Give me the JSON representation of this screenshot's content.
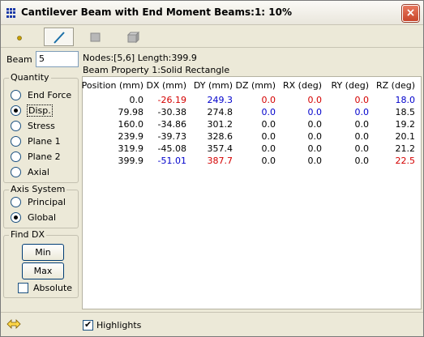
{
  "window": {
    "title": "Cantilever Beam with End Moment Beams:1: 10%",
    "close_glyph": "×"
  },
  "toolbar": {
    "buttons": [
      {
        "icon": "node-dot-icon",
        "active": false
      },
      {
        "icon": "beam-line-icon",
        "active": true
      },
      {
        "icon": "plate-icon",
        "active": false
      },
      {
        "icon": "brick-icon",
        "active": false
      }
    ]
  },
  "beam": {
    "label": "Beam",
    "value": "5"
  },
  "info": {
    "nodes_line": "Nodes:[5,6] Length:399.9",
    "property_line": "Beam Property 1:Solid Rectangle"
  },
  "quantity": {
    "title": "Quantity",
    "options": [
      "End Force",
      "Disp.",
      "Stress",
      "Plane 1",
      "Plane 2",
      "Axial"
    ],
    "selected": "Disp."
  },
  "axis_system": {
    "title": "Axis System",
    "options": [
      "Principal",
      "Global"
    ],
    "selected": "Global"
  },
  "find_dx": {
    "title": "Find DX",
    "min_label": "Min",
    "max_label": "Max",
    "absolute_label": "Absolute",
    "absolute_checked": false
  },
  "table": {
    "headers": [
      "Position (mm)",
      "DX (mm)",
      "DY (mm)",
      "DZ (mm)",
      "RX (deg)",
      "RY (deg)",
      "RZ (deg)"
    ],
    "rows": [
      [
        "0.0",
        "-26.19",
        "249.3",
        "0.0",
        "0.0",
        "0.0",
        "18.0"
      ],
      [
        "79.98",
        "-30.38",
        "274.8",
        "0.0",
        "0.0",
        "0.0",
        "18.5"
      ],
      [
        "160.0",
        "-34.86",
        "301.2",
        "0.0",
        "0.0",
        "0.0",
        "19.2"
      ],
      [
        "239.9",
        "-39.73",
        "328.6",
        "0.0",
        "0.0",
        "0.0",
        "20.1"
      ],
      [
        "319.9",
        "-45.08",
        "357.4",
        "0.0",
        "0.0",
        "0.0",
        "21.2"
      ],
      [
        "399.9",
        "-51.01",
        "387.7",
        "0.0",
        "0.0",
        "0.0",
        "22.5"
      ]
    ],
    "colors": [
      [
        "#000000",
        "#d40000",
        "#0000cc",
        "#d40000",
        "#d40000",
        "#d40000",
        "#0000cc"
      ],
      [
        "#000000",
        "#000000",
        "#000000",
        "#0000cc",
        "#0000cc",
        "#0000cc",
        "#000000"
      ],
      [
        "#000000",
        "#000000",
        "#000000",
        "#000000",
        "#000000",
        "#000000",
        "#000000"
      ],
      [
        "#000000",
        "#000000",
        "#000000",
        "#000000",
        "#000000",
        "#000000",
        "#000000"
      ],
      [
        "#000000",
        "#000000",
        "#000000",
        "#000000",
        "#000000",
        "#000000",
        "#000000"
      ],
      [
        "#000000",
        "#0000cc",
        "#d40000",
        "#000000",
        "#000000",
        "#000000",
        "#d40000"
      ]
    ]
  },
  "footer": {
    "nav_icon": "double-arrow-icon",
    "highlights_label": "Highlights",
    "highlights_checked": true
  }
}
